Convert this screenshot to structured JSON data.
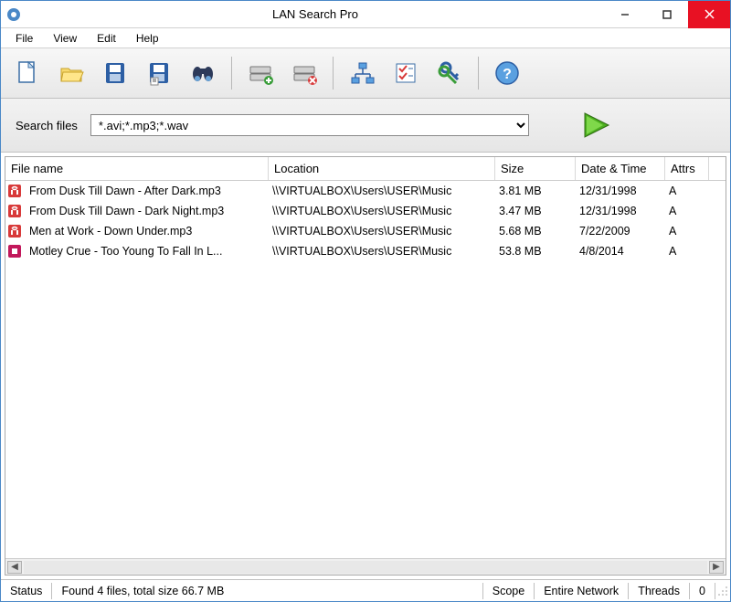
{
  "title": "LAN Search Pro",
  "menu": [
    "File",
    "View",
    "Edit",
    "Help"
  ],
  "toolbar_icons": [
    "new-file",
    "open-folder",
    "save",
    "save-batch",
    "binoculars",
    "drive-add",
    "drive-remove",
    "network",
    "checklist",
    "keys",
    "help"
  ],
  "search": {
    "label": "Search files",
    "value": "*.avi;*.mp3;*.wav"
  },
  "columns": {
    "name": "File name",
    "location": "Location",
    "size": "Size",
    "date": "Date & Time",
    "attrs": "Attrs"
  },
  "rows": [
    {
      "icon": "audio",
      "name": "From Dusk Till Dawn - After Dark.mp3",
      "location": "\\\\VIRTUALBOX\\Users\\USER\\Music",
      "size": "3.81 MB",
      "date": "12/31/1998",
      "attrs": "A"
    },
    {
      "icon": "audio",
      "name": "From Dusk Till Dawn - Dark Night.mp3",
      "location": "\\\\VIRTUALBOX\\Users\\USER\\Music",
      "size": "3.47 MB",
      "date": "12/31/1998",
      "attrs": "A"
    },
    {
      "icon": "audio",
      "name": "Men at Work - Down Under.mp3",
      "location": "\\\\VIRTUALBOX\\Users\\USER\\Music",
      "size": "5.68 MB",
      "date": "7/22/2009",
      "attrs": "A"
    },
    {
      "icon": "video",
      "name": "Motley Crue - Too Young To Fall In L...",
      "location": "\\\\VIRTUALBOX\\Users\\USER\\Music",
      "size": "53.8 MB",
      "date": "4/8/2014",
      "attrs": "A"
    }
  ],
  "status": {
    "label": "Status",
    "message": "Found 4 files, total size 66.7 MB",
    "scope_label": "Scope",
    "scope_value": "Entire Network",
    "threads_label": "Threads",
    "threads_value": "0"
  }
}
